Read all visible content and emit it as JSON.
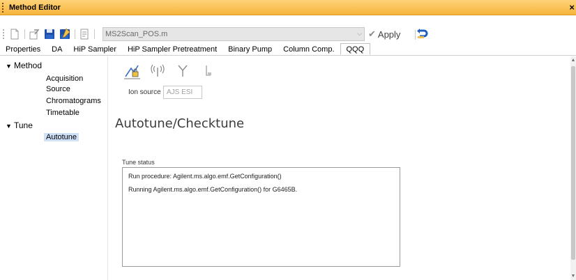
{
  "window": {
    "title": "Method Editor",
    "close_glyph": "×"
  },
  "toolbar": {
    "method_file": "MS2Scan_POS.m",
    "apply_label": "Apply",
    "icons": [
      "new-icon",
      "open-icon",
      "save-icon",
      "save-as-icon",
      "report-icon",
      "undo-icon"
    ]
  },
  "tabs": [
    "Properties",
    "DA",
    "HiP Sampler",
    "HiP Sampler Pretreatment",
    "Binary Pump",
    "Column Comp.",
    "QQQ"
  ],
  "active_tab": "QQQ",
  "tree": {
    "method": {
      "label": "Method",
      "children": [
        "Acquisition",
        "Source",
        "Chromatograms",
        "Timetable"
      ]
    },
    "tune": {
      "label": "Tune",
      "children": [
        "Autotune"
      ]
    },
    "selected": "Autotune"
  },
  "panel": {
    "icons": [
      "tune-lock-icon",
      "antenna-icon",
      "fork-icon",
      "probe-icon"
    ],
    "ion_source_label": "Ion source",
    "ion_source_value": "AJS ESI",
    "heading": "Autotune/Checktune",
    "tune_status_label": "Tune status",
    "status_lines": [
      "Run procedure: Agilent.ms.algo.emf.GetConfiguration()",
      "Running Agilent.ms.algo.emf.GetConfiguration() for G6465B."
    ]
  },
  "colors": {
    "titlebar": "#f7b53c",
    "selection": "#cfe0f7"
  }
}
